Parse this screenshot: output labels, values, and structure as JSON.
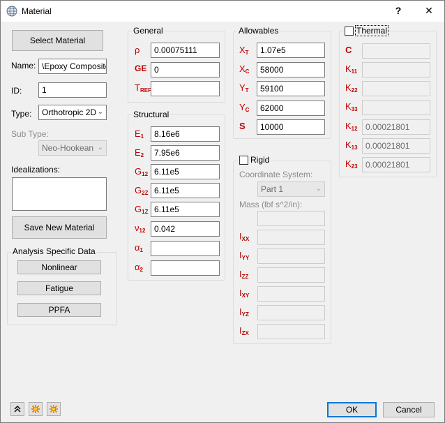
{
  "window": {
    "title": "Material",
    "help_label": "?",
    "close_label": "✕"
  },
  "left": {
    "select_material_label": "Select Material",
    "name_label": "Name:",
    "name_value": "\\Epoxy Composite",
    "id_label": "ID:",
    "id_value": "1",
    "type_label": "Type:",
    "type_value": "Orthotropic 2D",
    "subtype_label": "Sub Type:",
    "subtype_value": "Neo-Hookean",
    "idealizations_label": "Idealizations:",
    "save_new_material_label": "Save New Material",
    "analysis_group_title": "Analysis Specific Data",
    "nonlinear_label": "Nonlinear",
    "fatigue_label": "Fatigue",
    "ppfa_label": "PPFA"
  },
  "general": {
    "title": "General",
    "rho_sym": "ρ",
    "rho_value": "0.00075111",
    "ge_sym": "GE",
    "ge_value": "0",
    "tref_sym": "T",
    "tref_sub": "REF",
    "tref_value": ""
  },
  "structural": {
    "title": "Structural",
    "rows": [
      {
        "sym": "E",
        "sub": "1",
        "value": "8.16e6"
      },
      {
        "sym": "E",
        "sub": "2",
        "value": "7.95e6"
      },
      {
        "sym": "G",
        "sub": "12",
        "value": "6.11e5"
      },
      {
        "sym": "G",
        "sub": "2Z",
        "value": "6.11e5"
      },
      {
        "sym": "G",
        "sub": "1Z",
        "value": "6.11e5"
      },
      {
        "sym": "ν",
        "sub": "12",
        "value": "0.042"
      },
      {
        "sym": "α",
        "sub": "1",
        "value": ""
      },
      {
        "sym": "α",
        "sub": "2",
        "value": ""
      }
    ]
  },
  "allowables": {
    "title": "Allowables",
    "rows": [
      {
        "sym": "X",
        "sub": "T",
        "value": "1.07e5"
      },
      {
        "sym": "X",
        "sub": "C",
        "value": "58000"
      },
      {
        "sym": "Y",
        "sub": "T",
        "value": "59100"
      },
      {
        "sym": "Y",
        "sub": "C",
        "value": "62000"
      },
      {
        "sym": "S",
        "sub": "",
        "value": "10000"
      }
    ]
  },
  "rigid": {
    "title": "Rigid",
    "coord_label": "Coordinate System:",
    "coord_value": "Part 1",
    "mass_label": "Mass (lbf s^2/in):",
    "rows": [
      {
        "sym": "I",
        "sub": "XX"
      },
      {
        "sym": "I",
        "sub": "YY"
      },
      {
        "sym": "I",
        "sub": "ZZ"
      },
      {
        "sym": "I",
        "sub": "XY"
      },
      {
        "sym": "I",
        "sub": "YZ"
      },
      {
        "sym": "I",
        "sub": "ZX"
      }
    ]
  },
  "thermal": {
    "title": "Thermal",
    "rows": [
      {
        "sym": "C",
        "sub": "",
        "value": ""
      },
      {
        "sym": "K",
        "sub": "11",
        "value": ""
      },
      {
        "sym": "K",
        "sub": "22",
        "value": ""
      },
      {
        "sym": "K",
        "sub": "33",
        "value": ""
      },
      {
        "sym": "K",
        "sub": "12",
        "value": "0.00021801"
      },
      {
        "sym": "K",
        "sub": "13",
        "value": "0.00021801"
      },
      {
        "sym": "K",
        "sub": "23",
        "value": "0.00021801"
      }
    ]
  },
  "footer": {
    "ok_label": "OK",
    "cancel_label": "Cancel"
  }
}
